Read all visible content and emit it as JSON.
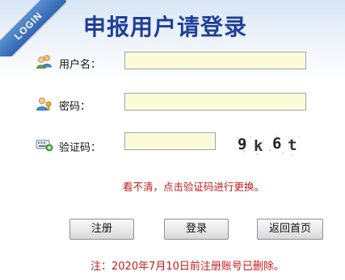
{
  "corner_badge": "LOGIN",
  "title": "申报用户请登录",
  "form": {
    "username_label": "用户名：",
    "username_value": "",
    "password_label": "密码：",
    "password_value": "",
    "captcha_label": "验证码：",
    "captcha_value": "",
    "captcha_image_text": [
      "9",
      "k",
      "6",
      "t"
    ]
  },
  "hint": "看不清，点击验证码进行更换。",
  "buttons": {
    "register": "注册",
    "login": "登录",
    "back_home": "返回首页"
  },
  "notice": "注：2020年7月10日前注册账号已删除。",
  "icons": {
    "username": "users-icon",
    "password": "user-key-icon",
    "captcha": "keyboard-add-icon"
  },
  "colors": {
    "title": "#1f3f9a",
    "input_bg": "#fcfbd8",
    "warning": "#c81a1a",
    "badge": "#2f66b4"
  }
}
